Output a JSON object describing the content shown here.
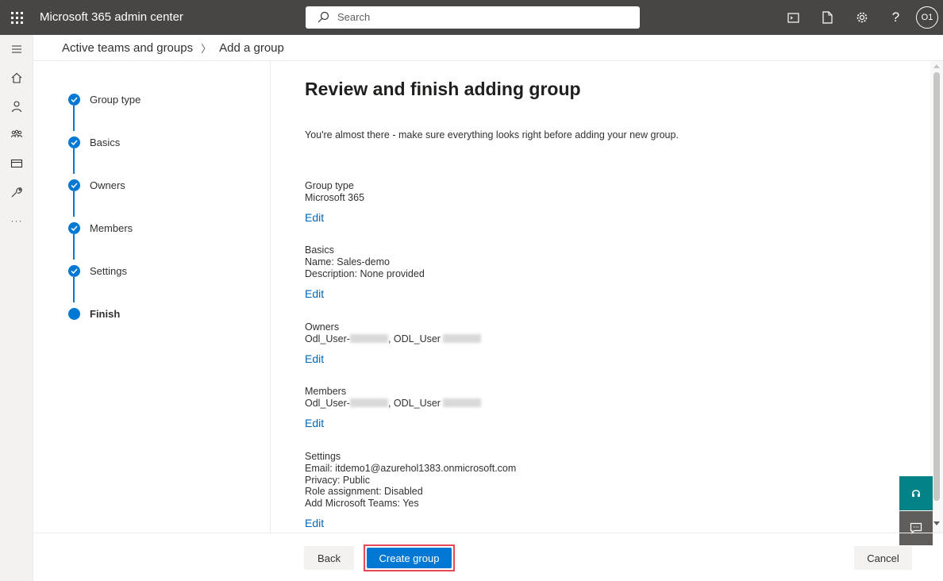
{
  "app": {
    "title": "Microsoft 365 admin center"
  },
  "search": {
    "placeholder": "Search"
  },
  "user": {
    "initials": "O1"
  },
  "breadcrumb": {
    "parent": "Active teams and groups",
    "current": "Add a group"
  },
  "steps": [
    {
      "label": "Group type",
      "state": "completed"
    },
    {
      "label": "Basics",
      "state": "completed"
    },
    {
      "label": "Owners",
      "state": "completed"
    },
    {
      "label": "Members",
      "state": "completed"
    },
    {
      "label": "Settings",
      "state": "completed"
    },
    {
      "label": "Finish",
      "state": "current"
    }
  ],
  "main": {
    "title": "Review and finish adding group",
    "intro": "You're almost there - make sure everything looks right before adding your new group.",
    "edit_label": "Edit",
    "sections": {
      "group_type": {
        "title": "Group type",
        "lines": [
          "Microsoft 365"
        ]
      },
      "basics": {
        "title": "Basics",
        "lines": [
          "Name: Sales-demo",
          "Description: None provided"
        ]
      },
      "owners": {
        "title": "Owners",
        "part1": "Odl_User-",
        "part2": ", ODL_User "
      },
      "members": {
        "title": "Members",
        "part1": "Odl_User-",
        "part2": ", ODL_User "
      },
      "settings": {
        "title": "Settings",
        "lines": [
          "Email: itdemo1@azurehol1383.onmicrosoft.com",
          "Privacy: Public",
          "Role assignment: Disabled",
          "Add Microsoft Teams: Yes"
        ]
      }
    }
  },
  "footer": {
    "back": "Back",
    "create": "Create group",
    "cancel": "Cancel"
  },
  "colors": {
    "accent": "#0078d4",
    "topbar": "#484644",
    "highlight": "#e74856",
    "help": "#038387"
  }
}
